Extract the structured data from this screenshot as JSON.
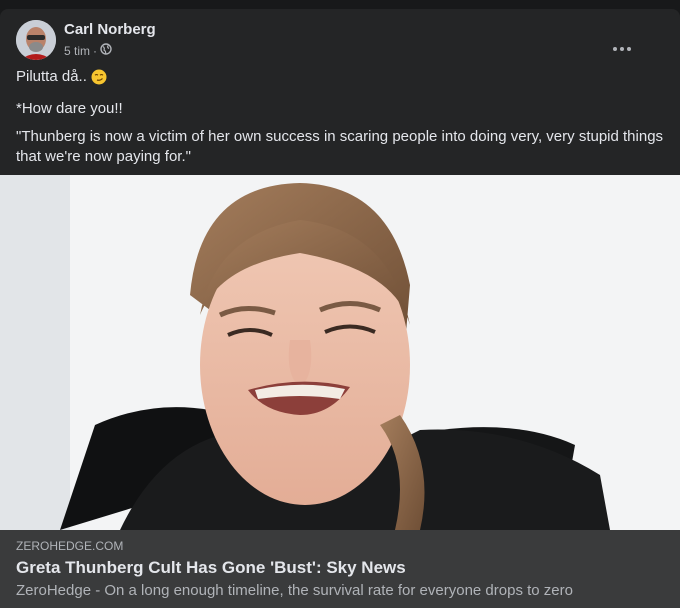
{
  "post": {
    "author": "Carl Norberg",
    "time": "5 tim",
    "separator": "·",
    "privacy_icon": "globe-icon",
    "text_lines": [
      "Pilutta då..",
      "*How dare you!!",
      "\"Thunberg is now a victim of her own success in scaring people into doing very, very stupid things that we're now paying for.\""
    ],
    "emoji": "smirk-emoji"
  },
  "link": {
    "domain": "ZEROHEDGE.COM",
    "title": "Greta Thunberg Cult Has Gone 'Bust': Sky News",
    "description": "ZeroHedge - On a long enough timeline, the survival rate for everyone drops to zero"
  },
  "colors": {
    "background": "#18191a",
    "card": "#242526",
    "link_box": "#3a3b3c",
    "primary_text": "#e4e6eb",
    "secondary_text": "#b0b3b8"
  }
}
